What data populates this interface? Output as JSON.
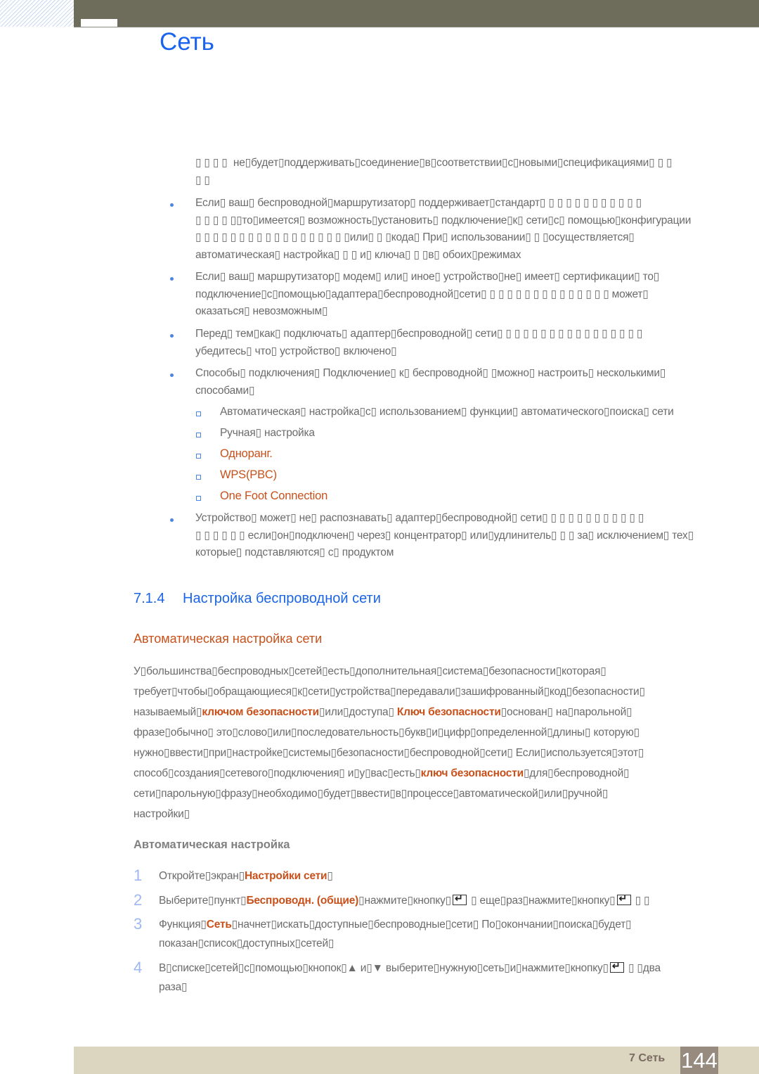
{
  "header": {
    "title": "Сеть"
  },
  "intro_lines": [
    [
      {
        "t": "▯ ▯ ▯ ▯  не▯будет▯поддерживать▯соединение▯в▯соответствии▯с▯новыми▯спецификациями▯ ▯ ▯"
      }
    ],
    [
      {
        "t": "▯ ▯"
      }
    ]
  ],
  "bullets": [
    {
      "lines": [
        [
          {
            "t": "Если▯ ваш▯ беспроводной▯маршрутизатор▯ поддерживает▯стандарт▯ ▯ ▯ ▯ ▯ ▯ ▯ ▯ ▯ ▯ ▯ ▯"
          }
        ],
        [
          {
            "t": "▯ ▯ ▯ ▯ ▯▯то▯имеется▯ возможность▯установить▯ подключение▯к▯ сети▯с▯ помощью▯конфигурации"
          }
        ],
        [
          {
            "t": "▯ ▯ ▯ ▯ ▯ ▯ ▯ ▯ ▯ ▯ ▯ ▯ ▯ ▯ ▯ ▯ ▯ ▯или▯ ▯ ▯кода▯ При▯ использовании▯ ▯ ▯осуществляется▯"
          }
        ],
        [
          {
            "t": "автоматическая▯ настройка▯ ▯ ▯ и▯ ключа▯ ▯ ▯в▯ обоих▯режимах"
          }
        ]
      ]
    },
    {
      "lines": [
        [
          {
            "t": "Если▯ ваш▯ маршрутизатор▯ модем▯ или▯ иное▯ устройство▯не▯ имеет▯ сертификации▯ то▯"
          }
        ],
        [
          {
            "t": "подключение▯с▯помощью▯адаптера▯беспроводной▯сети▯ ▯ ▯ ▯ ▯ ▯ ▯ ▯ ▯ ▯ ▯ ▯ ▯ ▯ ▯ может▯"
          }
        ],
        [
          {
            "t": "оказаться▯ невозможным▯"
          }
        ]
      ]
    },
    {
      "lines": [
        [
          {
            "t": "Перед▯ тем▯как▯ подключать▯ адаптер▯беспроводной▯ сети▯ ▯ ▯ ▯ ▯ ▯ ▯ ▯ ▯ ▯ ▯ ▯ ▯ ▯ ▯ ▯ ▯"
          }
        ],
        [
          {
            "t": "убедитесь▯ что▯ устройство▯ включено▯"
          }
        ]
      ]
    },
    {
      "lines": [
        [
          {
            "t": "Способы▯ подключения▯ Подключение▯ к▯ беспроводной▯ ▯можно▯ настроить▯ несколькими▯"
          }
        ],
        [
          {
            "t": "способами▯"
          }
        ]
      ]
    }
  ],
  "sub_items": [
    {
      "label": "Автоматическая▯ настройка▯с▯ использованием▯ функции▯ автоматического▯поиска▯ сети",
      "highlight": false
    },
    {
      "label": "Ручная▯ настройка",
      "highlight": false
    },
    {
      "label": "Одноранг.",
      "highlight": true
    },
    {
      "label": "WPS(PBC)",
      "highlight": true
    },
    {
      "label": "One Foot Connection",
      "highlight": true
    }
  ],
  "last_bullet": {
    "lines": [
      [
        {
          "t": "Устройство▯ может▯ не▯ распознавать▯ адаптер▯беспроводной▯ сети▯ ▯ ▯ ▯ ▯ ▯ ▯ ▯ ▯ ▯ ▯ ▯"
        }
      ],
      [
        {
          "t": "▯ ▯ ▯ ▯ ▯ ▯ если▯он▯подключен▯ через▯ концентратор▯ или▯удлинитель▯ ▯ ▯ за▯ исключением▯ тех▯"
        }
      ],
      [
        {
          "t": "которые▯ подставляются▯ с▯ продуктом"
        }
      ]
    ]
  },
  "section": {
    "number": "7.1.4",
    "title": "Настройка беспроводной сети"
  },
  "subsection": "Автоматическая настройка сети",
  "paragraph_lines": [
    [
      {
        "t": "У▯большинства▯беспроводных▯сетей▯есть▯дополнительная▯система▯безопасности▯которая▯"
      }
    ],
    [
      {
        "t": "требует▯чтобы▯обращающиеся▯к▯сети▯устройства▯передавали▯зашифрованный▯код▯безопасности▯"
      }
    ],
    [
      {
        "t": "называемый▯"
      },
      {
        "t": "ключом безопасности",
        "b": true
      },
      {
        "t": "▯или▯доступа▯ "
      },
      {
        "t": "Ключ безопасности",
        "b": true
      },
      {
        "t": "▯основан▯ на▯парольной▯"
      }
    ],
    [
      {
        "t": "фразе▯обычно▯ это▯слово▯или▯последовательность▯букв▯и▯цифр▯определенной▯длины▯ которую▯"
      }
    ],
    [
      {
        "t": "нужно▯ввести▯при▯настройке▯системы▯безопасности▯беспроводной▯сети▯ Если▯используется▯этот▯"
      }
    ],
    [
      {
        "t": "способ▯создания▯сетевого▯подключения▯ и▯у▯вас▯есть▯"
      },
      {
        "t": "ключ безопасности",
        "b": true
      },
      {
        "t": "▯для▯беспроводной▯"
      }
    ],
    [
      {
        "t": "сети▯парольную▯фразу▯необходимо▯будет▯ввести▯в▯процессе▯автоматической▯или▯ручной▯"
      }
    ],
    [
      {
        "t": "настройки▯"
      }
    ]
  ],
  "procedure_title": "Автоматическая настройка",
  "steps": [
    {
      "number": "1",
      "lines": [
        [
          {
            "t": "Откройте▯экран▯"
          },
          {
            "t": "Настройки сети",
            "b": true
          },
          {
            "t": "▯"
          }
        ]
      ]
    },
    {
      "number": "2",
      "lines": [
        [
          {
            "t": "Выберите▯пункт▯"
          },
          {
            "t": "Беспроводн. (общие)",
            "b": true
          },
          {
            "t": "▯нажмите▯кнопку▯"
          },
          {
            "icon": "enter-key-icon"
          },
          {
            "t": " ▯ еще▯раз▯нажмите▯кнопку▯"
          },
          {
            "icon": "enter-key-icon"
          },
          {
            "t": " ▯ ▯"
          }
        ]
      ]
    },
    {
      "number": "3",
      "lines": [
        [
          {
            "t": "Функция▯"
          },
          {
            "t": "Сеть",
            "b": true
          },
          {
            "t": "▯начнет▯искать▯доступные▯беспроводные▯сети▯ По▯окончании▯поиска▯будет▯"
          }
        ],
        [
          {
            "t": "показан▯список▯доступных▯сетей▯"
          }
        ]
      ]
    },
    {
      "number": "4",
      "lines": [
        [
          {
            "t": "В▯списке▯сетей▯с▯помощью▯кнопок▯▲ и▯▼ выберите▯нужную▯сеть▯и▯нажмите▯кнопку▯"
          },
          {
            "icon": "enter-key-icon"
          },
          {
            "t": " ▯ ▯два"
          }
        ],
        [
          {
            "t": "раза▯"
          }
        ]
      ]
    }
  ],
  "footer": {
    "chapter": "7 Сеть",
    "page": "144"
  },
  "colors": {
    "accent_blue": "#1a64f0",
    "highlight_orange": "#c8501a",
    "header_bar": "#6e6c5a",
    "footer_bar": "#dcd6c0",
    "page_box": "#978a7f"
  }
}
